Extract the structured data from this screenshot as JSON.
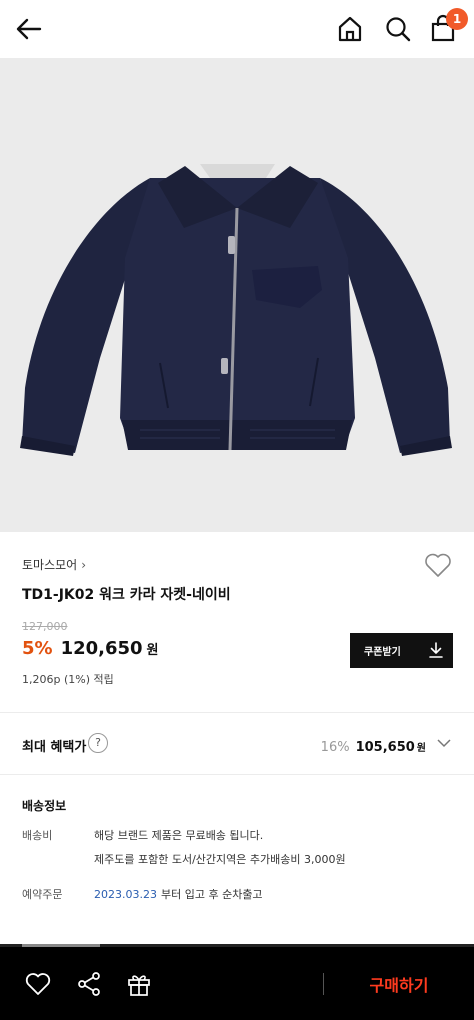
{
  "header": {
    "cart_count": "1",
    "icons": [
      "back-arrow-icon",
      "home-icon",
      "search-icon",
      "shopping-bag-icon"
    ]
  },
  "hero": {
    "image_subject": "navy zip-up work collar jacket",
    "background": "#ebebeb"
  },
  "product": {
    "brand": "토마스모어",
    "title": "TD1-JK02 워크 카라 자켓-네이비",
    "original_price": "127,000",
    "discount_rate": "5%",
    "sale_price": "120,650",
    "currency": "원",
    "points": "1,206p (1%) 적립"
  },
  "coupon": {
    "label": "쿠폰받기"
  },
  "benefit": {
    "label": "최대 혜택가",
    "help": "?",
    "rate": "16%",
    "price": "105,650",
    "currency": "원"
  },
  "shipping": {
    "title": "배송정보",
    "fee_label": "배송비",
    "fee_line1": "해당 브랜드 제품은 무료배송 됩니다.",
    "fee_line2": "제주도를 포함한 도서/산간지역은 추가배송비 3,000원",
    "preorder_label": "예약주문",
    "preorder_date": "2023.03.23",
    "preorder_text": "부터 입고 후 순차출고"
  },
  "bottom_bar": {
    "buy_label": "구매하기",
    "icons": [
      "heart-icon",
      "share-icon",
      "gift-icon"
    ]
  },
  "colors": {
    "accent": "#e2520f",
    "buy": "#ff3b1f",
    "badge": "#f15a29",
    "link": "#2a5db0"
  }
}
